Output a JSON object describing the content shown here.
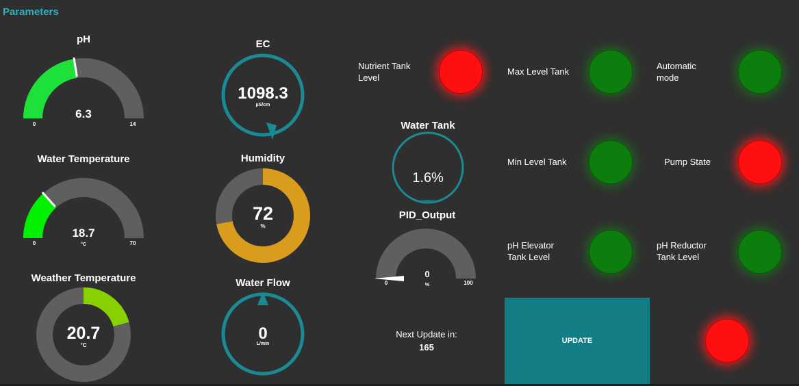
{
  "section_title": "Parameters",
  "gauges": {
    "ph": {
      "title": "pH",
      "value": "6.3",
      "min": "0",
      "max": "14",
      "level": 0.45
    },
    "water_temp": {
      "title": "Water Temperature",
      "value": "18.7",
      "unit": "°C",
      "min": "0",
      "max": "70",
      "level": 0.267
    },
    "weather_temp": {
      "title": "Weather Temperature",
      "value": "20.7",
      "unit": "°C",
      "level": 0.207
    },
    "ec": {
      "title": "EC",
      "value": "1098.3",
      "unit": "µS/cm"
    },
    "humidity": {
      "title": "Humidity",
      "value": "72",
      "unit": "%",
      "level": 0.72
    },
    "water_flow": {
      "title": "Water Flow",
      "value": "0",
      "unit": "L/min"
    },
    "water_tank": {
      "title": "Water Tank",
      "value": "1.6%",
      "level": 0.016
    },
    "pid_output": {
      "title": "PID_Output",
      "value": "0",
      "unit": "%",
      "min": "0",
      "max": "100",
      "level": 0
    }
  },
  "indicators": {
    "nutrient_tank_level": {
      "label_line1": "Nutrient Tank",
      "label_line2": "Level",
      "state": "red"
    },
    "max_level_tank": {
      "label": "Max Level Tank",
      "state": "green"
    },
    "automatic_mode": {
      "label_line1": "Automatic",
      "label_line2": "mode",
      "state": "green"
    },
    "min_level_tank": {
      "label": "Min Level Tank",
      "state": "green"
    },
    "pump_state": {
      "label": "Pump State",
      "state": "red"
    },
    "ph_elevator_tank_level": {
      "label_line1": "pH Elevator",
      "label_line2": "Tank Level",
      "state": "green"
    },
    "ph_reductor_tank_level": {
      "label_line1": "pH Reductor",
      "label_line2": "Tank Level",
      "state": "green"
    },
    "update_status": {
      "state": "red"
    }
  },
  "next_update": {
    "label": "Next Update in:",
    "value": "165"
  },
  "update_button": {
    "label": "UPDATE"
  },
  "colors": {
    "background": "#2f2f2f",
    "accent_teal": "#1b8a92",
    "gauge_track": "#5f5f5f",
    "ph_fill": "#1ee03a",
    "water_temp_fill": "#00f000",
    "weather_temp_fill": "#88d000",
    "humidity_fill": "#d99c1c",
    "led_red": "#ff1010",
    "led_green": "#0d7e0d",
    "button_bg": "#137d85"
  }
}
